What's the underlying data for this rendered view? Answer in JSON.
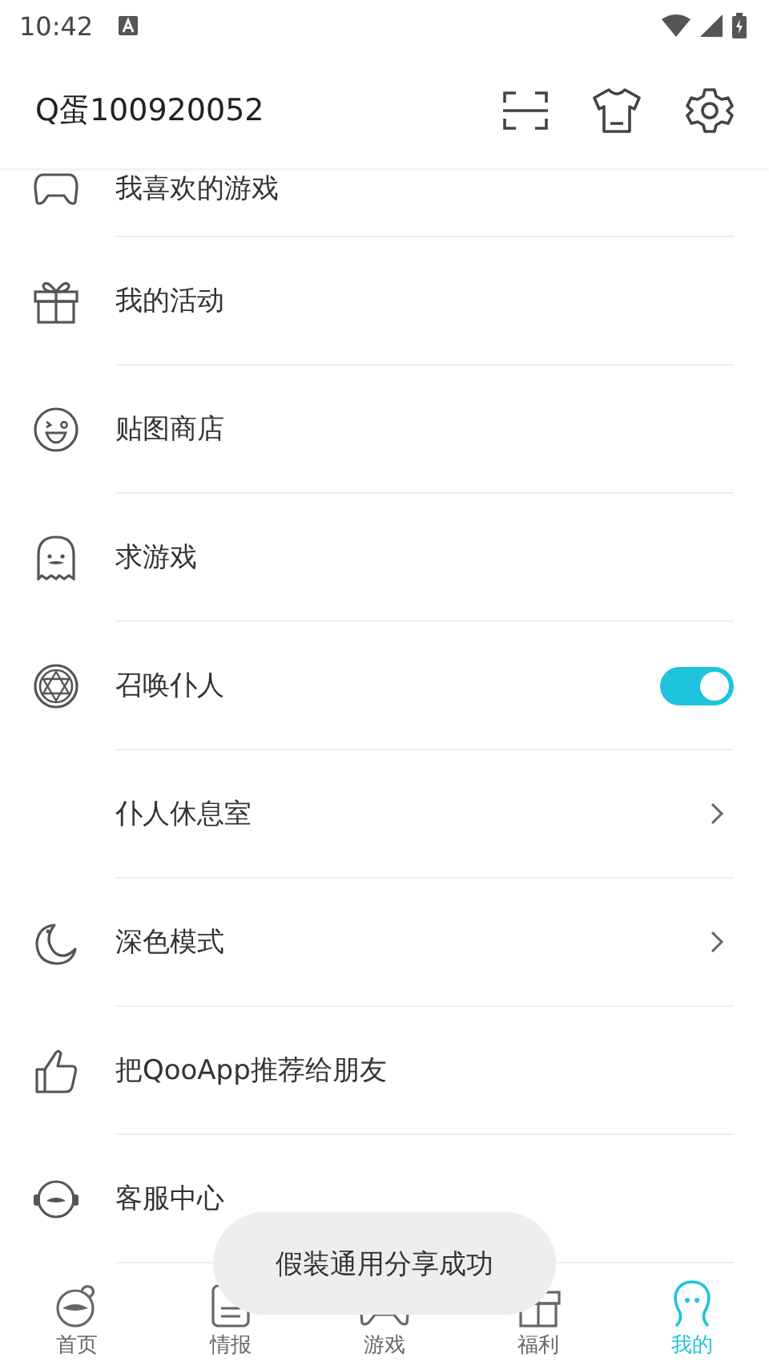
{
  "status_bar": {
    "time": "10:42"
  },
  "header": {
    "title": "Q蛋100920052"
  },
  "menu": [
    {
      "label": "我喜欢的游戏",
      "kind": "link"
    },
    {
      "label": "我的活动",
      "kind": "link"
    },
    {
      "label": "贴图商店",
      "kind": "link"
    },
    {
      "label": "求游戏",
      "kind": "link"
    },
    {
      "label": "召唤仆人",
      "kind": "toggle",
      "on": true
    },
    {
      "label": "仆人休息室",
      "kind": "chevron"
    },
    {
      "label": "深色模式",
      "kind": "chevron"
    },
    {
      "label": "把QooApp推荐给朋友",
      "kind": "link"
    },
    {
      "label": "客服中心",
      "kind": "link"
    }
  ],
  "toast": "假装通用分享成功",
  "tabs": [
    {
      "label": "首页",
      "selected": false
    },
    {
      "label": "情报",
      "selected": false
    },
    {
      "label": "游戏",
      "selected": false
    },
    {
      "label": "福利",
      "selected": false
    },
    {
      "label": "我的",
      "selected": true
    }
  ]
}
